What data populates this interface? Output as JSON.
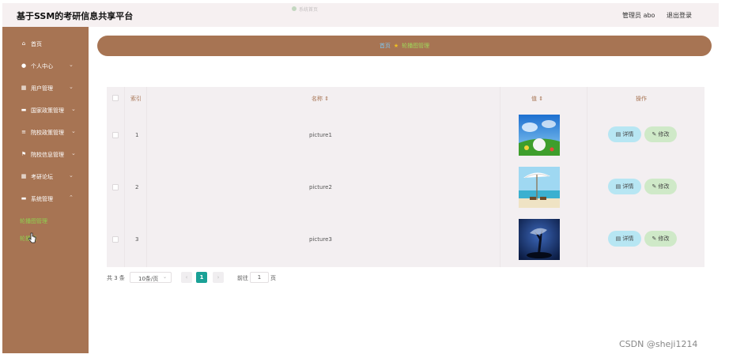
{
  "header": {
    "title": "基于SSM的考研信息共享平台",
    "hint": "系统首页",
    "user_label": "管理员 abo",
    "logout_label": "退出登录"
  },
  "sidebar": {
    "items": [
      {
        "label": "首页",
        "icon": "home-icon"
      },
      {
        "label": "个人中心",
        "icon": "user-icon"
      },
      {
        "label": "用户管理",
        "icon": "grid-icon"
      },
      {
        "label": "国家政策管理",
        "icon": "doc-icon"
      },
      {
        "label": "院校政策管理",
        "icon": "list-icon"
      },
      {
        "label": "院校信息管理",
        "icon": "flag-icon"
      },
      {
        "label": "考研论坛",
        "icon": "grid-icon"
      },
      {
        "label": "系统管理",
        "icon": "doc-icon"
      }
    ],
    "sub_items": [
      {
        "label": "轮播图管理"
      },
      {
        "label": "轮播图"
      }
    ]
  },
  "breadcrumb": {
    "home": "首页",
    "current": "轮播图管理"
  },
  "table": {
    "headers": {
      "index": "索引",
      "name": "名称",
      "value": "值",
      "actions": "操作"
    },
    "rows": [
      {
        "index": "1",
        "name": "picture1",
        "image": "flowers-meadow"
      },
      {
        "index": "2",
        "name": "picture2",
        "image": "beach-umbrella"
      },
      {
        "index": "3",
        "name": "picture3",
        "image": "dark-tree"
      }
    ],
    "detail_label": "详情",
    "edit_label": "修改"
  },
  "pagination": {
    "total": "共 3 条",
    "page_size": "10条/页",
    "current_page": "1",
    "goto_label": "前往",
    "goto_value": "1",
    "page_unit": "页"
  },
  "watermark": "CSDN @sheji1214",
  "colors": {
    "sidebar": "#a77453",
    "header": "#f6f0f1",
    "accent": "#1aa196",
    "detail_btn": "#b7e6f3",
    "edit_btn": "#cfe9c8"
  }
}
